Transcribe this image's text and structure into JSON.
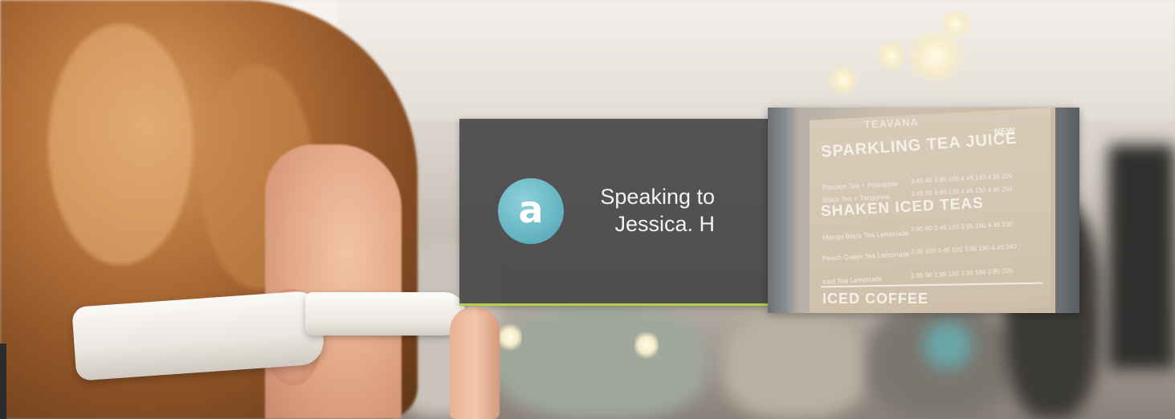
{
  "hud": {
    "logo_letter": "a",
    "line1": "Speaking to",
    "line2": "Jessica. H",
    "accent_color": "#b6cf4a",
    "logo_color": "#67b6c4"
  },
  "menu_board": {
    "brand": "TEAVANA",
    "heading1": "SPARKLING TEA JUICE",
    "heading1_badge": "NEW",
    "items1": [
      "Passion Tea + Pineapple",
      "Black Tea + Tangerine"
    ],
    "prices1": [
      "3.45  80  3.95  100  4.45  140  4.95  220",
      "3.45  90  3.95  120  4.45  150  4.95  250"
    ],
    "heading2": "SHAKEN ICED TEAS",
    "items2": [
      "Mango Black Tea Lemonade",
      "Peach Green Tea Lemonade",
      "Iced Tea Lemonade"
    ],
    "prices2": [
      "2.95  90  3.45  120  3.95  190  4.45  230",
      "2.95  100  3.45  120  3.95  190  4.45  240",
      "2.95  90  2.95  120  3.55  180  3.95  220"
    ],
    "heading3": "ICED COFFEE"
  }
}
